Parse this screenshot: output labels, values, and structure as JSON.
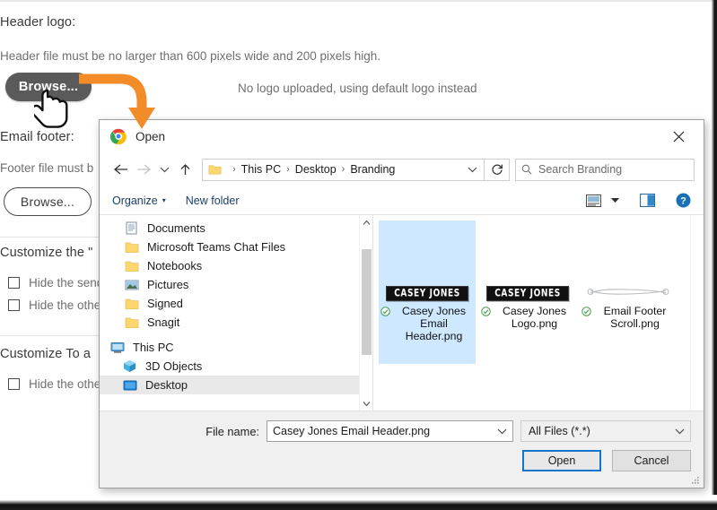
{
  "background": {
    "header_logo_label": "Header logo:",
    "header_note": "Header file must be no larger than 600 pixels wide and 200 pixels high.",
    "header_status": "No logo uploaded, using default logo instead",
    "header_browse_label": "Browse...",
    "email_footer_label": "Email footer:",
    "footer_note": "Footer file must b",
    "footer_browse_label": "Browse...",
    "customize_section_1": "Customize the \"",
    "customize_section_2": "Customize To a",
    "checkboxes": [
      {
        "label": "Hide the send"
      },
      {
        "label": "Hide the othe"
      },
      {
        "label": "Hide the othe"
      }
    ]
  },
  "dialog": {
    "title": "Open",
    "app_icon": "chrome-icon",
    "close_label": "✕",
    "nav": {
      "back_icon": "arrow-left-icon",
      "forward_icon": "arrow-right-icon",
      "recent_icon": "chevron-down-icon",
      "up_icon": "arrow-up-icon",
      "refresh_icon": "refresh-icon",
      "address_dropdown_icon": "chevron-down-icon",
      "breadcrumbs": [
        "This PC",
        "Desktop",
        "Branding"
      ],
      "breadcrumb_separator": "›"
    },
    "search": {
      "icon": "search-icon",
      "placeholder": "Search Branding"
    },
    "commandbar": {
      "organize_label": "Organize",
      "organize_caret": "▾",
      "new_folder_label": "New folder",
      "view_icon": "view-layout-icon",
      "view_caret": "▾",
      "preview_pane_icon": "preview-pane-icon",
      "help_icon": "help-icon"
    },
    "tree": {
      "items": [
        {
          "label": "Documents",
          "icon": "documents-icon",
          "level": 2,
          "selected": false
        },
        {
          "label": "Microsoft Teams Chat Files",
          "icon": "folder-icon",
          "level": 2,
          "selected": false
        },
        {
          "label": "Notebooks",
          "icon": "folder-icon",
          "level": 2,
          "selected": false
        },
        {
          "label": "Pictures",
          "icon": "pictures-icon",
          "level": 2,
          "selected": false
        },
        {
          "label": "Signed",
          "icon": "folder-icon",
          "level": 2,
          "selected": false
        },
        {
          "label": "Snagit",
          "icon": "folder-icon",
          "level": 2,
          "selected": false
        },
        {
          "label": "This PC",
          "icon": "this-pc-icon",
          "level": 1,
          "selected": false
        },
        {
          "label": "3D Objects",
          "icon": "3d-objects-icon",
          "level": 2,
          "selected": false
        },
        {
          "label": "Desktop",
          "icon": "desktop-icon",
          "level": 2,
          "selected": true
        }
      ],
      "scroll_up_icon": "chevron-up-icon",
      "scroll_down_icon": "chevron-down-icon"
    },
    "files": [
      {
        "name": "Casey Jones Email Header.png",
        "thumb_type": "logo-banner",
        "thumb_text": "CASEY JONES",
        "selected": true,
        "badge": "cloud-available-check"
      },
      {
        "name": "Casey Jones Logo.png",
        "thumb_type": "logo-banner",
        "thumb_text": "CASEY JONES",
        "selected": false,
        "badge": "cloud-available-check"
      },
      {
        "name": "Email Footer Scroll.png",
        "thumb_type": "scroll-flourish",
        "thumb_text": "",
        "selected": false,
        "badge": "cloud-available-check"
      }
    ],
    "footer": {
      "file_name_label": "File name:",
      "file_name_value": "Casey Jones Email Header.png",
      "file_name_chevron": "chevron-down-icon",
      "filter_value": "All Files (*.*)",
      "filter_chevron": "chevron-down-icon",
      "open_label": "Open",
      "cancel_label": "Cancel"
    }
  },
  "annotation": {
    "arrow_color": "#F28C28",
    "cursor_type": "pointing-hand"
  }
}
